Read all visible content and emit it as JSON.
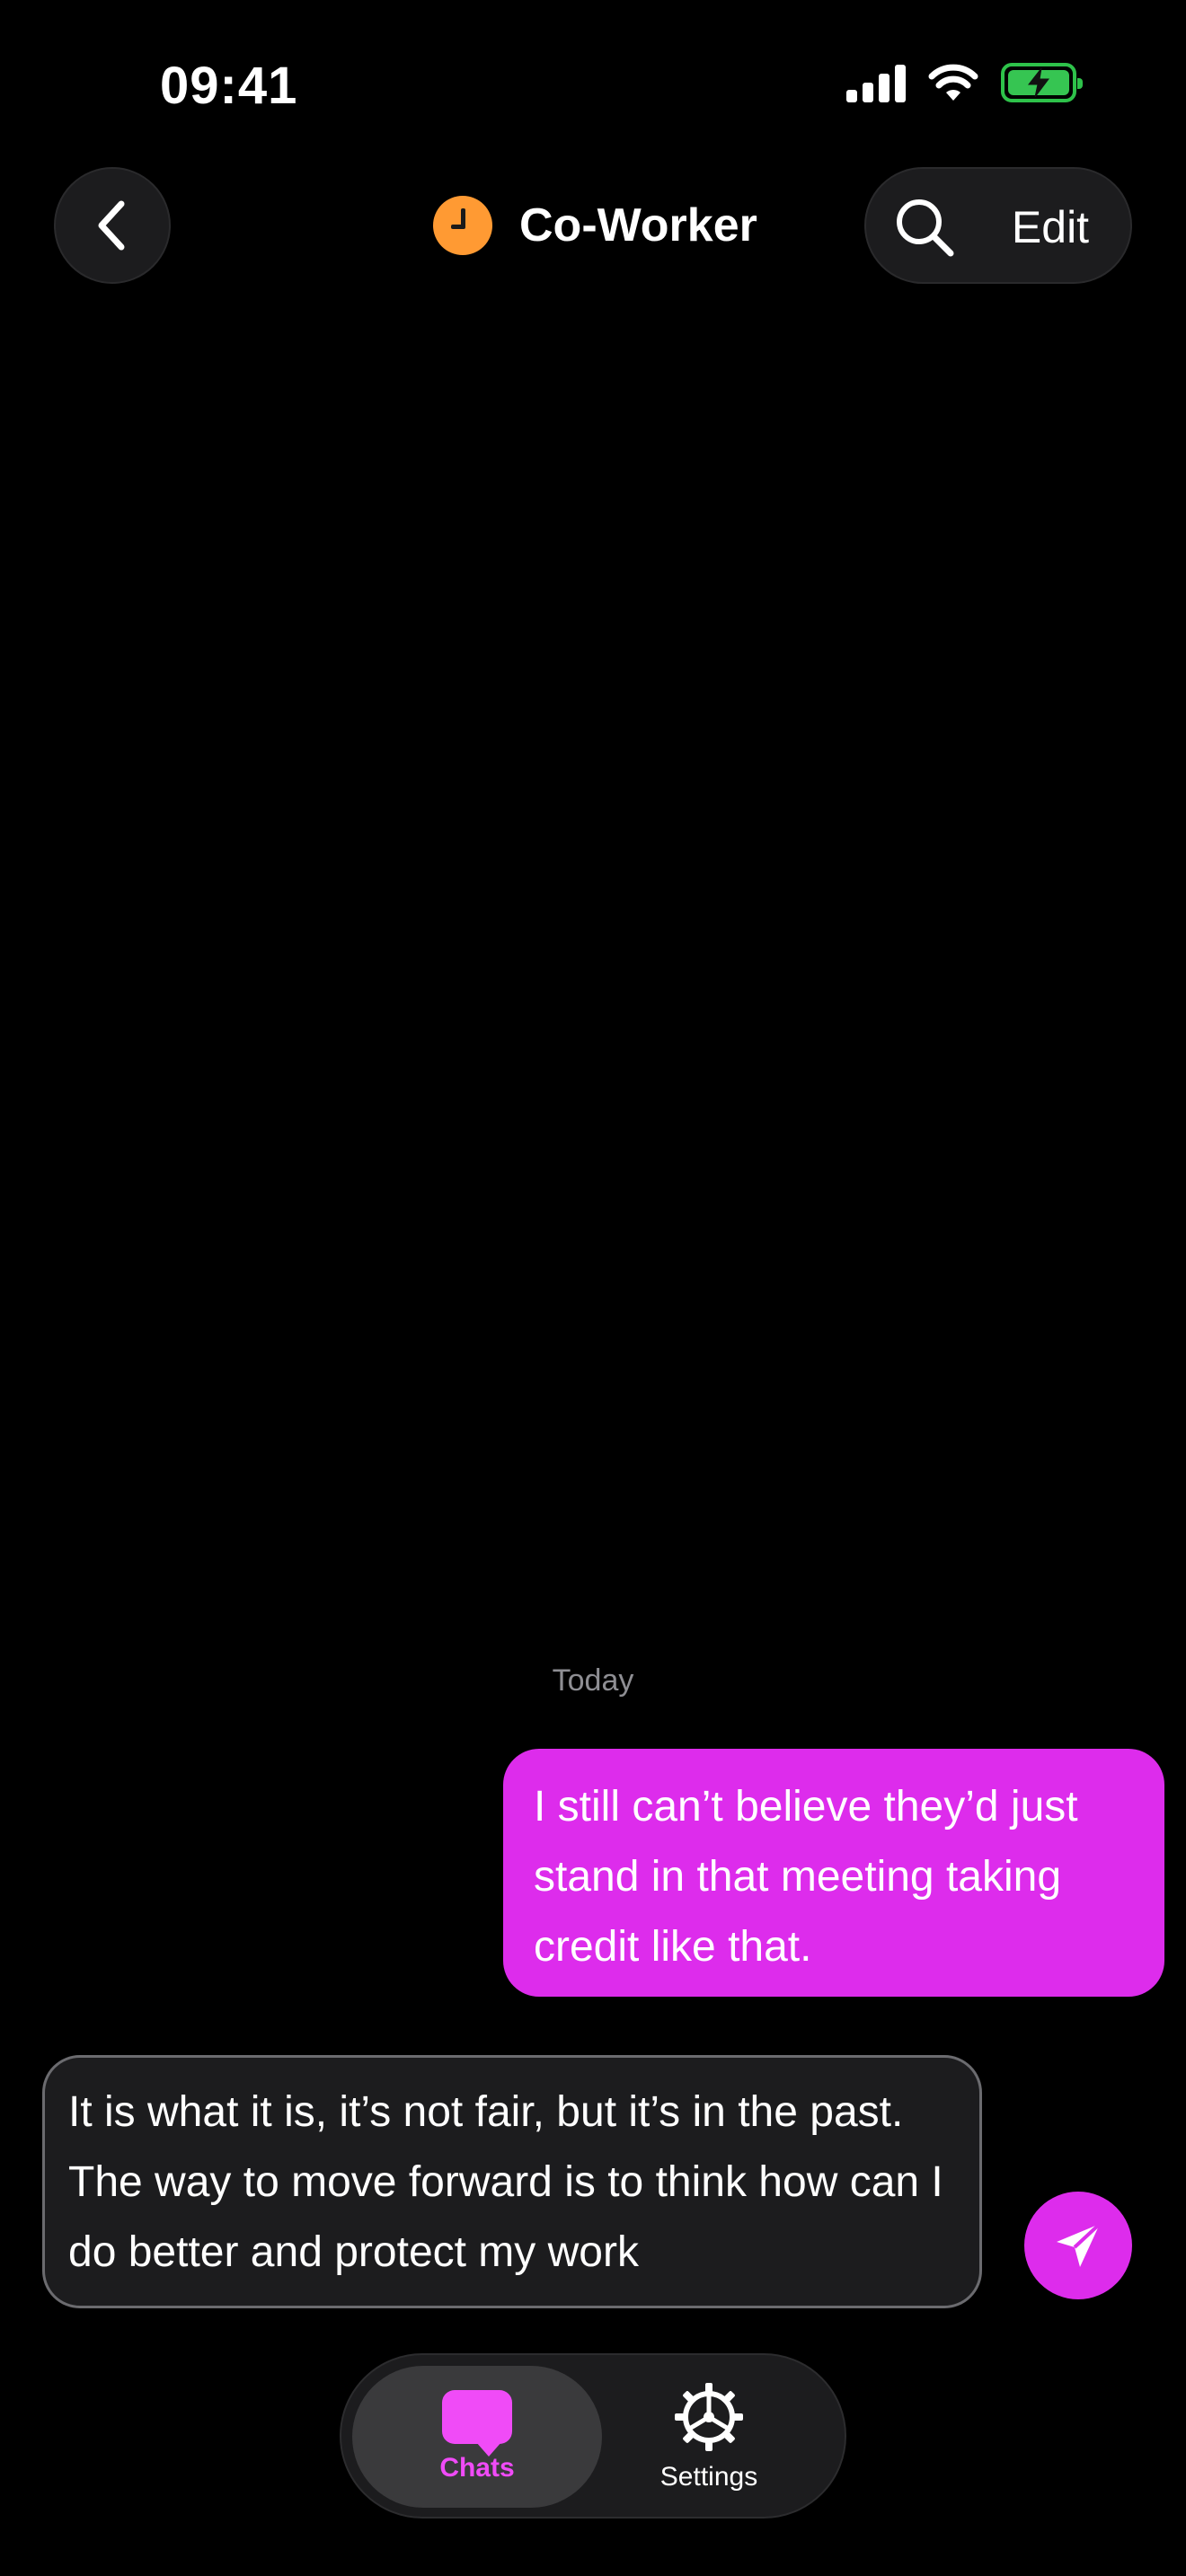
{
  "status_bar": {
    "time": "09:41"
  },
  "header": {
    "title": "Co-Worker",
    "edit_label": "Edit",
    "avatar_color": "#ff9a33"
  },
  "conversation": {
    "date_separator": "Today",
    "messages": [
      {
        "direction": "outgoing",
        "text": "I still can’t believe they’d just stand in that meeting taking credit like that."
      }
    ]
  },
  "composer": {
    "value": "It is what it is, it’s not fair, but it’s in the past. The way to move forward is to think how can I do better and protect my work"
  },
  "tab_bar": {
    "tabs": [
      {
        "label": "Chats",
        "icon": "chat-bubble-icon",
        "active": true
      },
      {
        "label": "Settings",
        "icon": "gear-icon",
        "active": false
      }
    ]
  },
  "colors": {
    "accent": "#dd2cec",
    "tab_active": "#f04bf7",
    "background": "#000000",
    "battery": "#36c552"
  }
}
